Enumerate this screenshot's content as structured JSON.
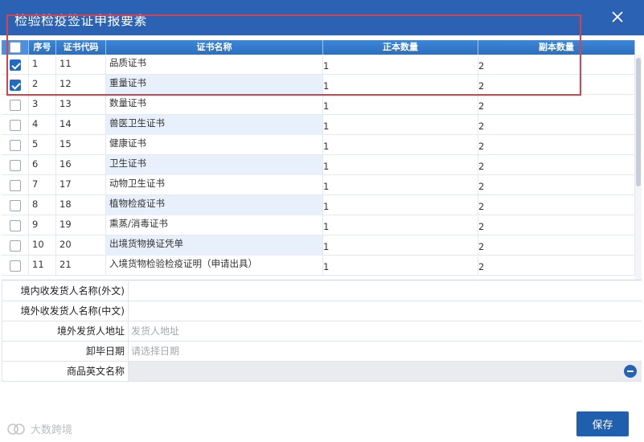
{
  "dialog": {
    "title": "检验检疫签证申报要素",
    "close_icon": "close-icon"
  },
  "grid": {
    "columns": {
      "seq": "序号",
      "code": "证书代码",
      "name": "证书名称",
      "original": "正本数量",
      "copy": "副本数量"
    },
    "rows": [
      {
        "checked": true,
        "seq": "1",
        "code": "11",
        "name": "品质证书",
        "original": "1",
        "copy": "2"
      },
      {
        "checked": true,
        "seq": "2",
        "code": "12",
        "name": "重量证书",
        "original": "1",
        "copy": "2"
      },
      {
        "checked": false,
        "seq": "3",
        "code": "13",
        "name": "数量证书",
        "original": "1",
        "copy": "2"
      },
      {
        "checked": false,
        "seq": "4",
        "code": "14",
        "name": "兽医卫生证书",
        "original": "1",
        "copy": "2"
      },
      {
        "checked": false,
        "seq": "5",
        "code": "15",
        "name": "健康证书",
        "original": "1",
        "copy": "2"
      },
      {
        "checked": false,
        "seq": "6",
        "code": "16",
        "name": "卫生证书",
        "original": "1",
        "copy": "2"
      },
      {
        "checked": false,
        "seq": "7",
        "code": "17",
        "name": "动物卫生证书",
        "original": "1",
        "copy": "2"
      },
      {
        "checked": false,
        "seq": "8",
        "code": "18",
        "name": "植物检疫证书",
        "original": "1",
        "copy": "2"
      },
      {
        "checked": false,
        "seq": "9",
        "code": "19",
        "name": "熏蒸/消毒证书",
        "original": "1",
        "copy": "2"
      },
      {
        "checked": false,
        "seq": "10",
        "code": "20",
        "name": "出境货物换证凭单",
        "original": "1",
        "copy": "2"
      },
      {
        "checked": false,
        "seq": "11",
        "code": "21",
        "name": "入境货物检验检疫证明（申请出具）",
        "original": "1",
        "copy": "2"
      }
    ]
  },
  "form": {
    "domestic_consignee_foreign": {
      "label": "境内收发货人名称(外文)",
      "value": ""
    },
    "foreign_consignee_chinese": {
      "label": "境外收发货人名称(中文)",
      "value": ""
    },
    "foreign_consignor_address": {
      "label": "境外发货人地址",
      "placeholder": "发货人地址"
    },
    "unloading_date": {
      "label": "卸毕日期",
      "placeholder": "请选择日期"
    },
    "goods_english_name": {
      "label": "商品英文名称",
      "value": ""
    }
  },
  "footer": {
    "save_label": "保存",
    "watermark": "大数跨境"
  },
  "colors": {
    "title_bar": "#2b62b4",
    "header": "#2c6fbf",
    "selection_box": "#d8424c",
    "save_button": "#1f5fae"
  }
}
